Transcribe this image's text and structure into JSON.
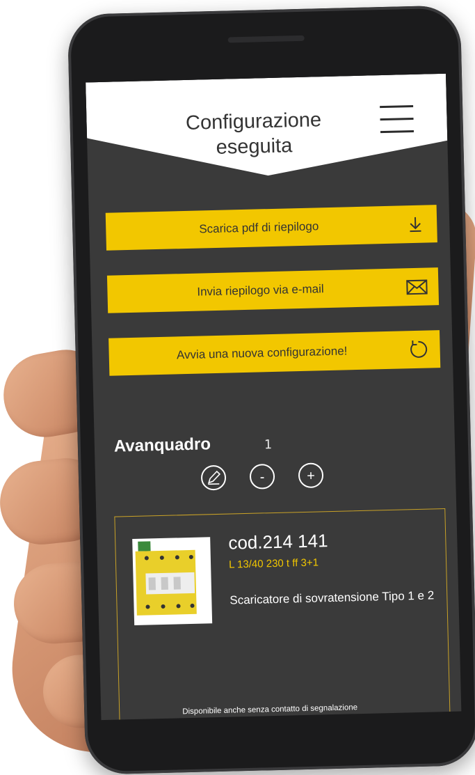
{
  "header": {
    "title": "Configurazione eseguita",
    "menu_icon": "hamburger-menu-icon"
  },
  "actions": [
    {
      "label": "Scarica pdf di riepilogo",
      "icon": "download-icon"
    },
    {
      "label": "Invia riepilogo via e-mail",
      "icon": "mail-icon"
    },
    {
      "label": "Avvia una nuova configurazione!",
      "icon": "refresh-icon"
    }
  ],
  "section": {
    "title": "Avanquadro",
    "count": "1",
    "controls": {
      "edit_icon": "pencil-icon",
      "minus": "-",
      "plus": "+"
    }
  },
  "product": {
    "code": "cod.214 141",
    "model": "L 13/40 230 t ff 3+1",
    "description": "Scaricatore di sovratensione Tipo 1 e 2",
    "note": "Disponibile anche senza contatto di segnalazione"
  },
  "colors": {
    "accent": "#f2c700",
    "screen_bg": "#3a3a3a",
    "header_bg": "#ffffff"
  }
}
